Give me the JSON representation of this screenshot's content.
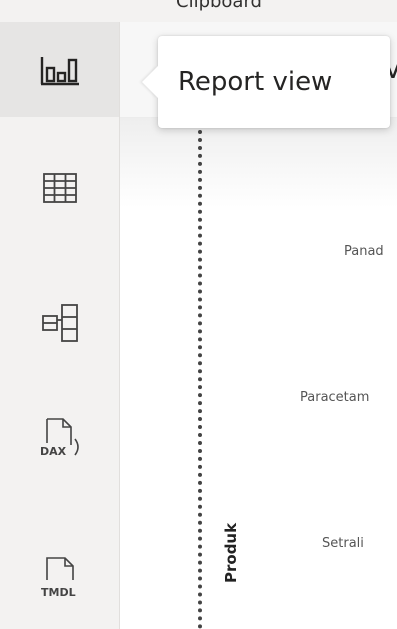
{
  "ribbon": {
    "group_label": "Clipboard"
  },
  "rail": {
    "items": [
      {
        "id": "report",
        "icon": "report-view-icon",
        "active": true
      },
      {
        "id": "table",
        "icon": "table-view-icon",
        "active": false
      },
      {
        "id": "model",
        "icon": "model-view-icon",
        "active": false
      },
      {
        "id": "dax",
        "icon": "dax-query-view-icon",
        "label": "DAX",
        "active": false
      },
      {
        "id": "tmdl",
        "icon": "tmdl-view-icon",
        "label": "TMDL",
        "active": false
      }
    ]
  },
  "tooltip": {
    "text": "Report view"
  },
  "canvas": {
    "peek_letter": "V",
    "axis_title": "Produk",
    "categories": [
      "Panad",
      "Paracetam",
      "Setrali"
    ]
  }
}
